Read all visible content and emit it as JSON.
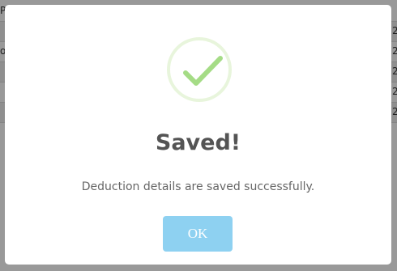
{
  "background": {
    "rows": [
      {
        "left": "P",
        "right": ""
      },
      {
        "left": "",
        "right": "2"
      },
      {
        "left": "o",
        "right": "2"
      },
      {
        "left": "",
        "right": "2"
      },
      {
        "left": "",
        "right": "2"
      },
      {
        "left": "",
        "right": "2"
      }
    ]
  },
  "dialog": {
    "icon": "checkmark-icon",
    "title": "Saved!",
    "message": "Deduction details are saved successfully.",
    "ok_label": "OK",
    "colors": {
      "check": "#a5dc86",
      "ring": "#e8f5dc",
      "button": "#8ed1f1"
    }
  }
}
